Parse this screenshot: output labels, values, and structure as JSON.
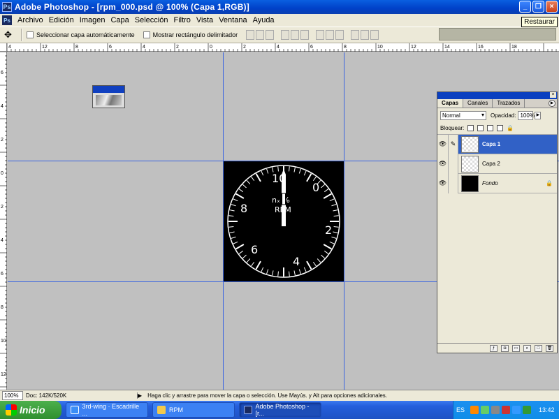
{
  "window": {
    "title": "Adobe Photoshop - [rpm_000.psd @ 100% (Capa 1,RGB)]",
    "app_icon_text": "Ps",
    "buttons": {
      "minimize": "_",
      "restore": "❐",
      "close": "×"
    },
    "tooltip": "Restaurar"
  },
  "menubar": {
    "items": [
      "Archivo",
      "Edición",
      "Imagen",
      "Capa",
      "Selección",
      "Filtro",
      "Vista",
      "Ventana",
      "Ayuda"
    ]
  },
  "options": {
    "move_tool_glyph": "✥",
    "auto_select_label": "Seleccionar capa automáticamente",
    "show_bounds_label": "Mostrar rectángulo delimitador"
  },
  "rulers": {
    "top_labels": [
      "4",
      "12",
      "8",
      "6",
      "4",
      "2",
      "0",
      "2",
      "4",
      "6",
      "8",
      "10",
      "12",
      "14",
      "16",
      "18"
    ],
    "left_labels": [
      "6",
      "4",
      "2",
      "0",
      "2",
      "4",
      "6",
      "8",
      "10",
      "12",
      "14"
    ]
  },
  "gauge": {
    "numbers": [
      "10",
      "0",
      "8",
      "2",
      "6",
      "4"
    ],
    "label_top": "nₓ %",
    "label_bottom": "RPM"
  },
  "layers_panel": {
    "tabs": [
      "Capas",
      "Canales",
      "Trazados"
    ],
    "blend_mode": "Normal",
    "opacity_label": "Opacidad:",
    "opacity_value": "100%",
    "lock_label": "Bloquear:",
    "layers": [
      {
        "name": "Capa 1",
        "selected": true
      },
      {
        "name": "Capa 2",
        "selected": false
      },
      {
        "name": "Fondo",
        "selected": false
      }
    ]
  },
  "statusbar": {
    "zoom": "100%",
    "doc_info": "Doc: 142K/520K",
    "hint": "Haga clic y arrastre para mover la capa o selección. Use Mayús. y Alt para opciones adicionales."
  },
  "taskbar": {
    "start_label": "Inicio",
    "tasks": [
      {
        "label": "3rd-wing · Escadrille ...",
        "active": false
      },
      {
        "label": "RPM",
        "active": false
      },
      {
        "label": "Adobe Photoshop - [r...",
        "active": true
      }
    ],
    "language": "ES",
    "clock": "13:42"
  }
}
